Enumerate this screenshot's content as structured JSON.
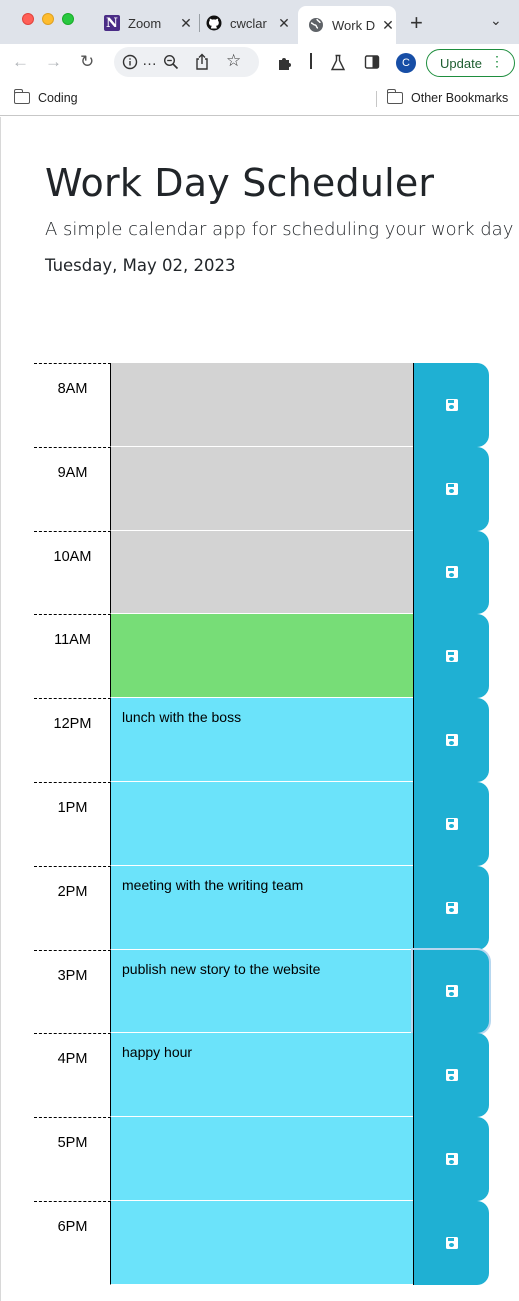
{
  "browser": {
    "tabs": [
      {
        "title": "Zoom",
        "icon": "notion-n-icon"
      },
      {
        "title": "cwclar",
        "icon": "github-icon"
      },
      {
        "title": "Work D",
        "icon": "globe-icon",
        "active": true
      }
    ],
    "new_tab_symbol": "+",
    "address_ellipsis": "…",
    "profile_initial": "C",
    "update_label": "Update",
    "bookmarks": {
      "left": "Coding",
      "right": "Other Bookmarks"
    }
  },
  "page": {
    "title": "Work Day Scheduler",
    "lead": "A simple calendar app for scheduling your work day",
    "current_day": "Tuesday, May 02, 2023"
  },
  "schedule": {
    "rows": [
      {
        "hour": "8AM",
        "text": "",
        "state": "past"
      },
      {
        "hour": "9AM",
        "text": "",
        "state": "past"
      },
      {
        "hour": "10AM",
        "text": "",
        "state": "past"
      },
      {
        "hour": "11AM",
        "text": "",
        "state": "present"
      },
      {
        "hour": "12PM",
        "text": "lunch with the boss",
        "state": "future"
      },
      {
        "hour": "1PM",
        "text": "",
        "state": "future"
      },
      {
        "hour": "2PM",
        "text": "meeting with the writing team",
        "state": "future"
      },
      {
        "hour": "3PM",
        "text": "publish new story to the website",
        "state": "future",
        "focused": true
      },
      {
        "hour": "4PM",
        "text": "happy hour",
        "state": "future"
      },
      {
        "hour": "5PM",
        "text": "",
        "state": "future"
      },
      {
        "hour": "6PM",
        "text": "",
        "state": "future"
      }
    ]
  },
  "colors": {
    "past": "#d3d3d3",
    "present": "#77dd77",
    "future": "#6be3fa",
    "save": "#1fb0d3"
  }
}
